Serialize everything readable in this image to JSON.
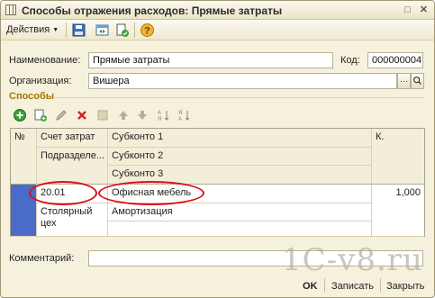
{
  "window": {
    "title": "Способы отражения расходов: Прямые затраты"
  },
  "toolbar": {
    "actions_label": "Действия",
    "icons": [
      "save-icon",
      "view-icon",
      "copy-doc-icon",
      "help-icon"
    ]
  },
  "form": {
    "name_label": "Наименование:",
    "name_value": "Прямые затраты",
    "code_label": "Код:",
    "code_value": "000000004",
    "org_label": "Организация:",
    "org_value": "Вишера",
    "section_title": "Способы",
    "comment_label": "Комментарий:",
    "comment_value": ""
  },
  "grid": {
    "headers": {
      "num": "№",
      "account": "Счет затрат",
      "subconto1": "Субконто 1",
      "coef": "К.",
      "subdivision": "Подразделе...",
      "subconto2": "Субконто 2",
      "subconto3": "Субконто 3"
    },
    "rows": [
      {
        "num": "",
        "account": "20.01",
        "subconto1": "Офисная мебель",
        "coef": "1,000",
        "subdivision": "Столярный цех",
        "subconto2": "Амортизация",
        "subconto3": ""
      }
    ]
  },
  "buttons": {
    "ok": "OK",
    "save": "Записать",
    "close": "Закрыть"
  },
  "watermark": "1C-v8.ru",
  "colors": {
    "window_bg": "#f5f1dc",
    "section_title": "#a07700",
    "row_marker": "#4a6bc7",
    "annotation": "#d8101b"
  }
}
